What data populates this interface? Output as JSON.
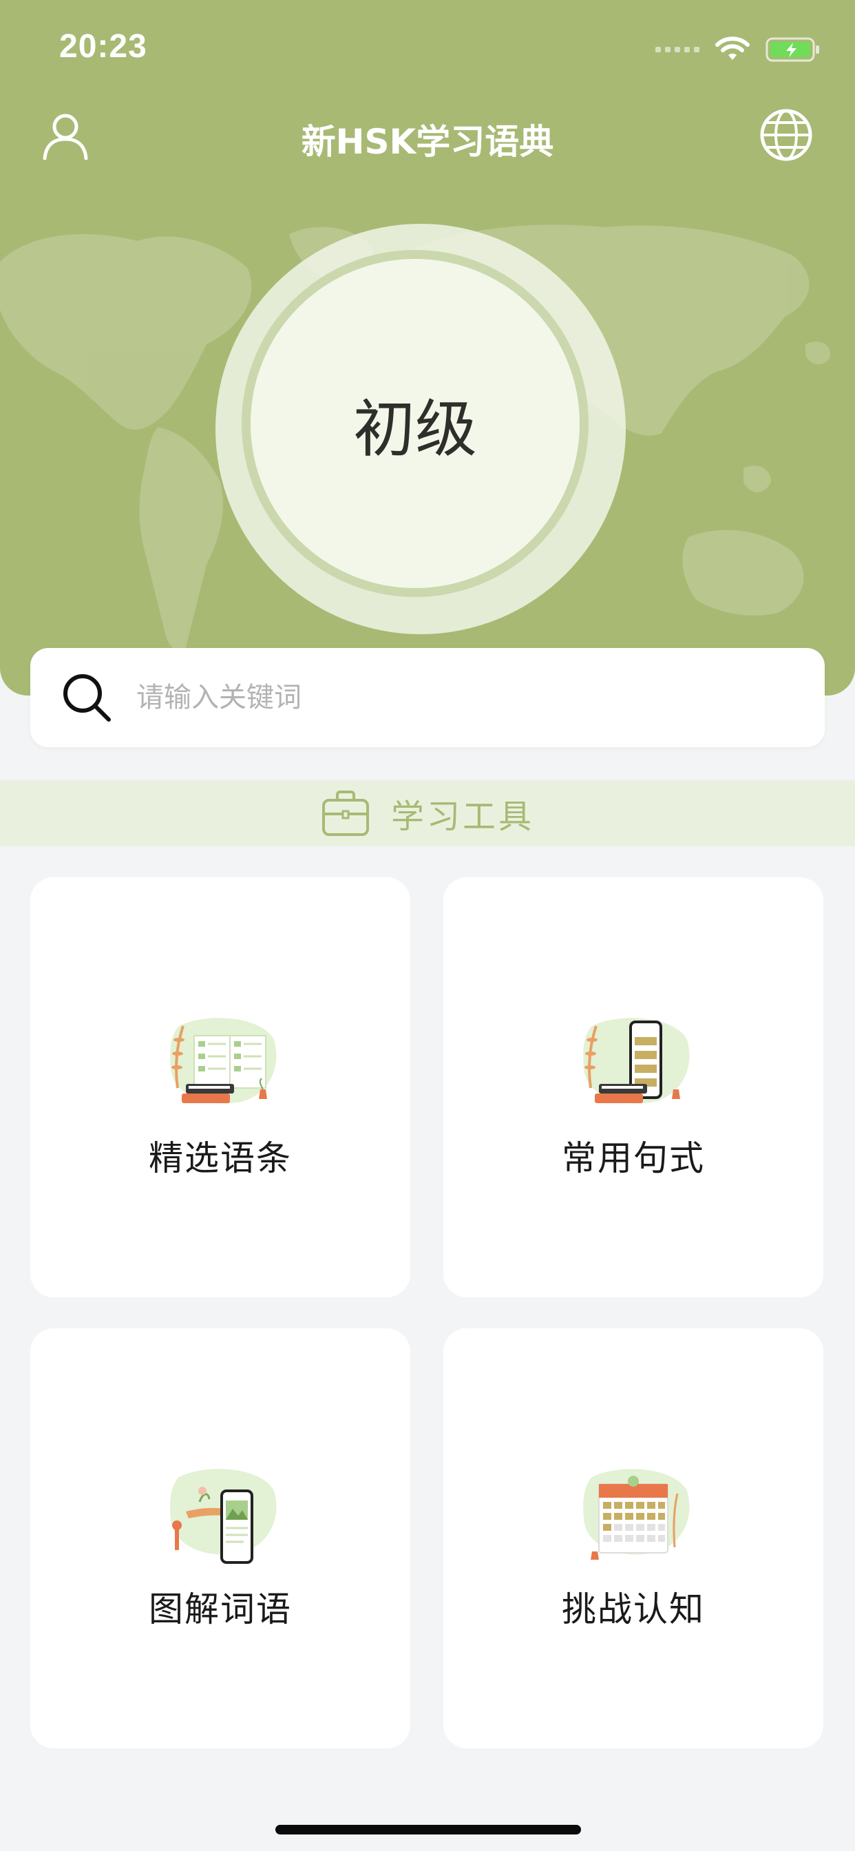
{
  "status_bar": {
    "time": "20:23"
  },
  "nav": {
    "title": "新HSK学习语典"
  },
  "level": {
    "label": "初级"
  },
  "search": {
    "placeholder": "请输入关键词"
  },
  "section": {
    "title": "学习工具"
  },
  "cards": [
    {
      "label": "精选语条"
    },
    {
      "label": "常用句式"
    },
    {
      "label": "图解词语"
    },
    {
      "label": "挑战认知"
    }
  ],
  "colors": {
    "header_green": "#a8b974",
    "section_bg": "#e9f1de",
    "ring": "#cbd7ad",
    "orange": "#e8784a"
  }
}
